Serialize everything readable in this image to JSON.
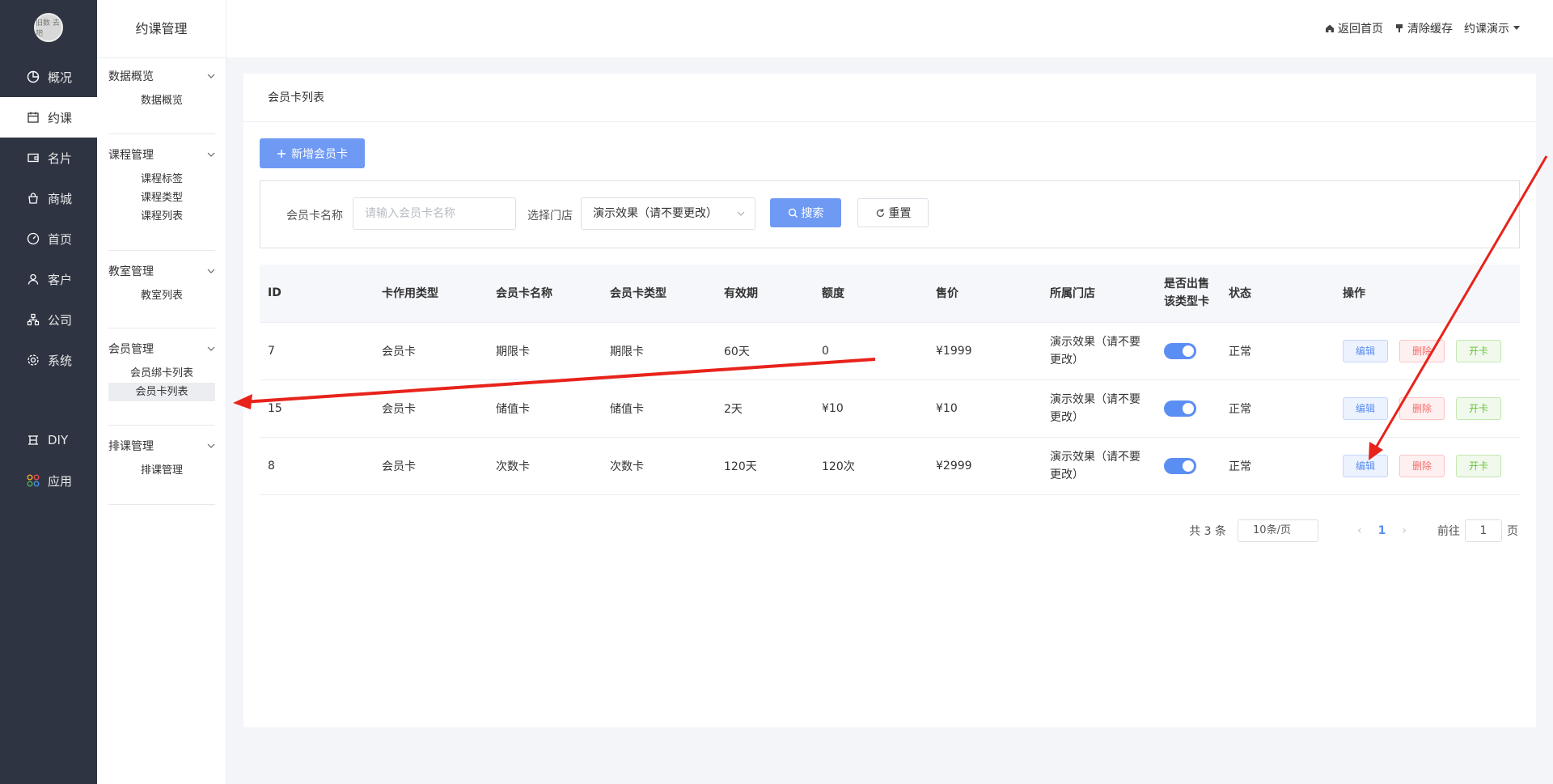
{
  "nav": {
    "logo_text": "旧数 去吧",
    "items": [
      {
        "label": "概况",
        "icon": "pie-chart-icon"
      },
      {
        "label": "约课",
        "icon": "calendar-icon"
      },
      {
        "label": "名片",
        "icon": "wallet-icon"
      },
      {
        "label": "商城",
        "icon": "shop-bag-icon"
      },
      {
        "label": "首页",
        "icon": "dashboard-icon"
      },
      {
        "label": "客户",
        "icon": "user-icon"
      },
      {
        "label": "公司",
        "icon": "org-icon"
      },
      {
        "label": "系统",
        "icon": "gear-icon"
      },
      {
        "label": "DIY",
        "icon": "diy-icon"
      },
      {
        "label": "应用",
        "icon": "apps-icon"
      }
    ]
  },
  "submenu": {
    "title": "约课管理",
    "groups": [
      {
        "label": "数据概览",
        "links": [
          "数据概览"
        ]
      },
      {
        "label": "课程管理",
        "links": [
          "课程标签",
          "课程类型",
          "课程列表"
        ]
      },
      {
        "label": "教室管理",
        "links": [
          "教室列表"
        ]
      },
      {
        "label": "会员管理",
        "links": [
          "会员绑卡列表",
          "会员卡列表"
        ]
      },
      {
        "label": "排课管理",
        "links": [
          "排课管理"
        ]
      }
    ]
  },
  "header": {
    "home": "返回首页",
    "clear_cache": "清除缓存",
    "user": "约课演示"
  },
  "page": {
    "title": "会员卡列表",
    "add_button": "新增会员卡",
    "search": {
      "name_label": "会员卡名称",
      "name_placeholder": "请输入会员卡名称",
      "store_label": "选择门店",
      "store_value": "演示效果（请不要更改）",
      "search_button": "搜索",
      "reset_button": "重置"
    }
  },
  "table": {
    "headers": [
      "ID",
      "卡作用类型",
      "会员卡名称",
      "会员卡类型",
      "有效期",
      "额度",
      "售价",
      "所属门店",
      "是否出售该类型卡",
      "状态",
      "操作"
    ],
    "rows": [
      {
        "id": "7",
        "use_type": "会员卡",
        "name": "期限卡",
        "card_type": "期限卡",
        "validity": "60天",
        "amount": "0",
        "price": "¥1999",
        "store": "演示效果（请不要更改）",
        "on_sale": true,
        "status": "正常"
      },
      {
        "id": "15",
        "use_type": "会员卡",
        "name": "储值卡",
        "card_type": "储值卡",
        "validity": "2天",
        "amount": "¥10",
        "price": "¥10",
        "store": "演示效果（请不要更改）",
        "on_sale": true,
        "status": "正常"
      },
      {
        "id": "8",
        "use_type": "会员卡",
        "name": "次数卡",
        "card_type": "次数卡",
        "validity": "120天",
        "amount": "120次",
        "price": "¥2999",
        "store": "演示效果（请不要更改）",
        "on_sale": true,
        "status": "正常"
      }
    ],
    "actions": {
      "edit": "编辑",
      "delete": "删除",
      "open": "开卡"
    }
  },
  "pagination": {
    "total": "共 3 条",
    "page_size": "10条/页",
    "current": "1",
    "goto_label": "前往",
    "goto_value": "1",
    "page_suffix": "页"
  },
  "colors": {
    "sidebar": "#2e3442",
    "primary": "#6f9af4",
    "annotation_arrow": "#e8231b"
  }
}
